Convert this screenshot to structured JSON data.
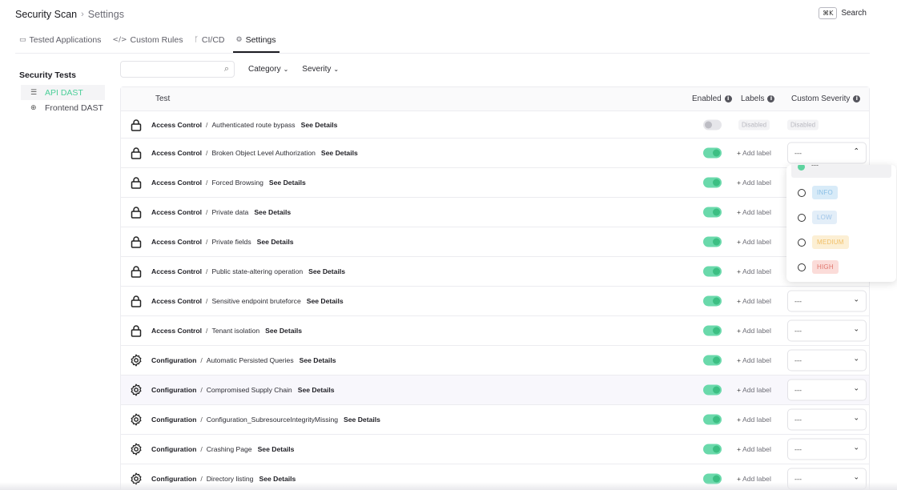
{
  "header": {
    "app": "Security Scan",
    "separator": "›",
    "page": "Settings",
    "search_kbd": "⌘K",
    "search_label": "Search"
  },
  "tabs": [
    {
      "label": "Tested Applications",
      "icon": "window-icon"
    },
    {
      "label": "Custom Rules",
      "icon": "code-icon"
    },
    {
      "label": "CI/CD",
      "icon": "branch-icon"
    },
    {
      "label": "Settings",
      "icon": "gear-icon",
      "active": true
    }
  ],
  "sidebar": {
    "title": "Security Tests",
    "items": [
      {
        "label": "API DAST",
        "icon": "server-icon",
        "active": true
      },
      {
        "label": "Frontend DAST",
        "icon": "globe-icon"
      }
    ]
  },
  "toolbar": {
    "search_placeholder": "",
    "filters": [
      "Category",
      "Severity"
    ]
  },
  "table": {
    "columns": {
      "test": "Test",
      "enabled": "Enabled",
      "labels": "Labels",
      "custom_severity": "Custom Severity"
    },
    "see_details": "See Details",
    "add_label": "Add label",
    "disabled_text": "Disabled",
    "severity_default": "---",
    "rows": [
      {
        "category": "Access Control",
        "name": "Authenticated route bypass",
        "icon": "lock-icon",
        "enabled": false
      },
      {
        "category": "Access Control",
        "name": "Broken Object Level Authorization",
        "icon": "lock-icon",
        "enabled": true,
        "dropdown_open": true
      },
      {
        "category": "Access Control",
        "name": "Forced Browsing",
        "icon": "lock-icon",
        "enabled": true
      },
      {
        "category": "Access Control",
        "name": "Private data",
        "icon": "lock-icon",
        "enabled": true
      },
      {
        "category": "Access Control",
        "name": "Private fields",
        "icon": "lock-icon",
        "enabled": true
      },
      {
        "category": "Access Control",
        "name": "Public state-altering operation",
        "icon": "lock-icon",
        "enabled": true
      },
      {
        "category": "Access Control",
        "name": "Sensitive endpoint bruteforce",
        "icon": "lock-icon",
        "enabled": true
      },
      {
        "category": "Access Control",
        "name": "Tenant isolation",
        "icon": "lock-icon",
        "enabled": true
      },
      {
        "category": "Configuration",
        "name": "Automatic Persisted Queries",
        "icon": "gear-icon",
        "enabled": true
      },
      {
        "category": "Configuration",
        "name": "Compromised Supply Chain",
        "icon": "gear-icon",
        "enabled": true,
        "highlighted": true
      },
      {
        "category": "Configuration",
        "name": "Configuration_SubresourceIntegrityMissing",
        "icon": "gear-icon",
        "enabled": true
      },
      {
        "category": "Configuration",
        "name": "Crashing Page",
        "icon": "gear-icon",
        "enabled": true
      },
      {
        "category": "Configuration",
        "name": "Directory listing",
        "icon": "gear-icon",
        "enabled": true
      }
    ]
  },
  "dropdown": {
    "selected": "---",
    "options": [
      {
        "label": "INFO",
        "color": "#8cc0e6"
      },
      {
        "label": "LOW",
        "color": "#9ec4e8"
      },
      {
        "label": "MEDIUM",
        "color": "#f1bf66"
      },
      {
        "label": "HIGH",
        "color": "#e0776e"
      }
    ]
  },
  "colors": {
    "accent": "#4ccf99",
    "toggle_on": "#6ad9ab",
    "text": "#1f1f24"
  }
}
